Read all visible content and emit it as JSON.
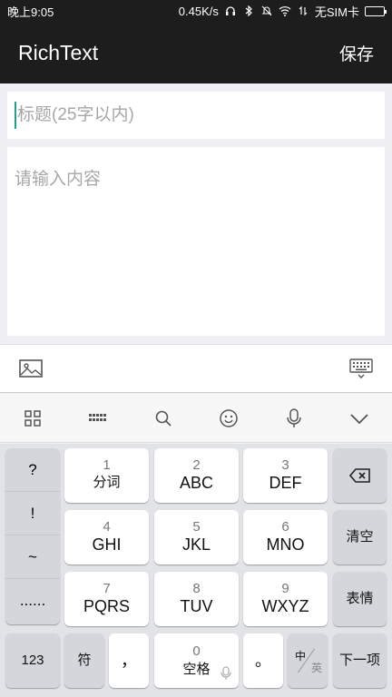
{
  "status_bar": {
    "time": "晚上9:05",
    "speed": "0.45K/s",
    "carrier": "无SIM卡"
  },
  "app_bar": {
    "title": "RichText",
    "save_label": "保存"
  },
  "editor": {
    "title_placeholder": "标题(25字以内)",
    "title_value": "",
    "content_placeholder": "请输入内容",
    "content_value": ""
  },
  "toolbar": {
    "left_icon": "image-icon",
    "right_icon": "keyboard-hide-icon"
  },
  "keyboard_topbar": {
    "icons": [
      "grid-icon",
      "keyboard-icon",
      "search-icon",
      "emoji-icon",
      "mic-icon",
      "chevron-down-icon"
    ]
  },
  "keyboard": {
    "symbols": [
      "?",
      "!",
      "~",
      "......"
    ],
    "keys": [
      {
        "num": "1",
        "label": "分词"
      },
      {
        "num": "2",
        "label": "ABC"
      },
      {
        "num": "3",
        "label": "DEF"
      },
      {
        "num": "4",
        "label": "GHI"
      },
      {
        "num": "5",
        "label": "JKL"
      },
      {
        "num": "6",
        "label": "MNO"
      },
      {
        "num": "7",
        "label": "PQRS"
      },
      {
        "num": "8",
        "label": "TUV"
      },
      {
        "num": "9",
        "label": "WXYZ"
      }
    ],
    "clear_label": "清空",
    "emoticon_label": "表情",
    "num_label": "123",
    "symbol_label": "符",
    "comma_label": "，",
    "space_num": "0",
    "space_label": "空格",
    "period_label": "。",
    "lang_zh": "中",
    "lang_en": "英",
    "next_label": "下一项"
  }
}
